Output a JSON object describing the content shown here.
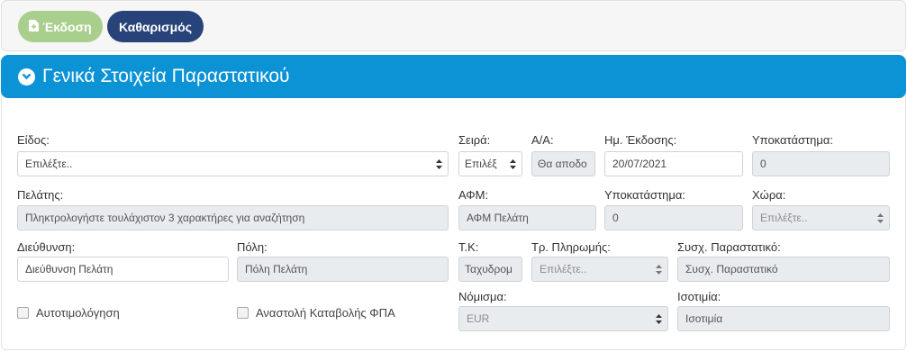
{
  "toolbar": {
    "issue_label": "Έκδοση",
    "clear_label": "Καθαρισμός",
    "issue_color": "#a9cf8d",
    "clear_color": "#27437a"
  },
  "panel": {
    "title": "Γενικά Στοιχεία Παραστατικού",
    "header_color": "#0b93d5"
  },
  "form": {
    "type_label": "Είδος:",
    "type_value": "Επιλέξτε..",
    "series_label": "Σειρά:",
    "series_value": "Επιλέξ",
    "aa_label": "Α/Α:",
    "aa_value": "Θα αποδο",
    "issue_date_label": "Ημ. Έκδοσης:",
    "issue_date_value": "20/07/2021",
    "branch_label": "Υποκατάστημα:",
    "branch_value": "0",
    "customer_label": "Πελάτης:",
    "customer_placeholder": "Πληκτρολογήστε τουλάχιστον 3 χαρακτήρες για αναζήτηση",
    "afm_label": "ΑΦΜ:",
    "afm_placeholder": "ΑΦΜ Πελάτη",
    "customer_branch_label": "Υποκατάστημα:",
    "customer_branch_value": "0",
    "country_label": "Χώρα:",
    "country_value": "Επιλέξτε..",
    "address_label": "Διεύθυνση:",
    "address_placeholder": "Διεύθυνση Πελάτη",
    "city_label": "Πόλη:",
    "city_placeholder": "Πόλη Πελάτη",
    "zip_label": "Τ.Κ:",
    "zip_placeholder": "Ταχυδρομ",
    "payment_label": "Τρ. Πληρωμής:",
    "payment_value": "Επιλέξτε..",
    "related_label": "Συσχ. Παραστατικό:",
    "related_placeholder": "Συσχ. Παραστατικό",
    "self_invoice_label": "Αυτοτιμολόγηση",
    "vat_suspension_label": "Αναστολή Καταβολής ΦΠΑ",
    "currency_label": "Νόμισμα:",
    "currency_value": "EUR",
    "parity_label": "Ισοτιμία:",
    "parity_placeholder": "Ισοτιμία"
  },
  "icons": {
    "issue": "file-plus-icon",
    "header": "chevron-circle-down-icon",
    "select": "sort-arrows-icon"
  }
}
